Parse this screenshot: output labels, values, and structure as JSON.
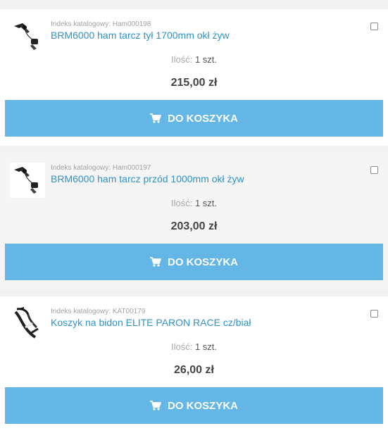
{
  "products": [
    {
      "index_label": "Indeks katalogowy:",
      "index_value": "Ham000198",
      "title": "BRM6000 ham tarcz tył 1700mm okł żyw",
      "qty_label": "Ilość:",
      "qty_value": "1 szt.",
      "price": "215,00 zł",
      "button_label": "DO KOSZYKA",
      "image_icon": "brake-lever-icon"
    },
    {
      "index_label": "Indeks katalogowy:",
      "index_value": "Ham000197",
      "title": "BRM6000 ham tarcz przód 1000mm okł żyw",
      "qty_label": "Ilość:",
      "qty_value": "1 szt.",
      "price": "203,00 zł",
      "button_label": "DO KOSZYKA",
      "image_icon": "brake-lever-icon"
    },
    {
      "index_label": "Indeks katalogowy:",
      "index_value": "KAT00179",
      "title": "Koszyk na bidon ELITE PARON RACE cz/biał",
      "qty_label": "Ilość:",
      "qty_value": "1 szt.",
      "price": "26,00 zł",
      "button_label": "DO KOSZYKA",
      "image_icon": "bottle-cage-icon"
    }
  ],
  "colors": {
    "accent_button": "#63b6e6",
    "link": "#2e93c8"
  }
}
